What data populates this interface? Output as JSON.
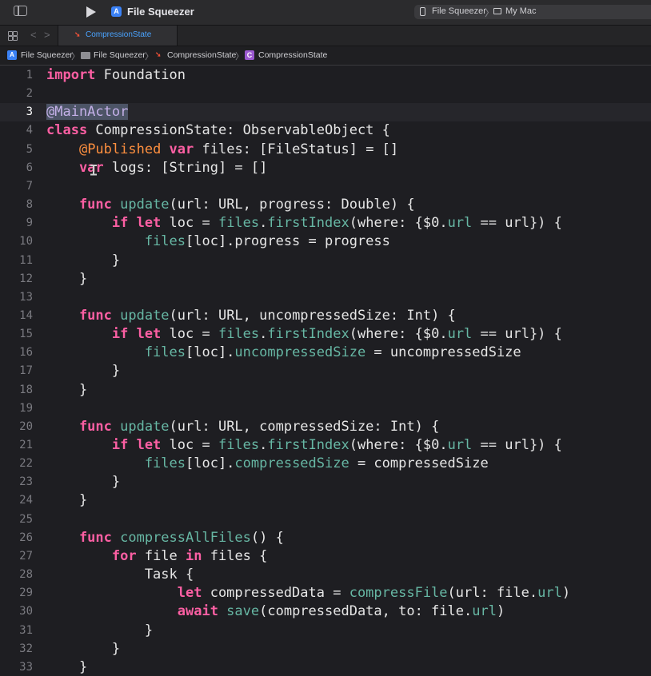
{
  "toolbar": {
    "project_title": "File Squeezer",
    "scheme": "File Squeezer",
    "destination": "My Mac"
  },
  "tabs": [
    {
      "label": "CompressionState",
      "active": true,
      "icon": "swift-icon"
    }
  ],
  "breadcrumb": [
    {
      "label": "File Squeezer",
      "icon": "project-icon"
    },
    {
      "label": "File Squeezer",
      "icon": "folder-icon"
    },
    {
      "label": "CompressionState",
      "icon": "swift-file-icon"
    },
    {
      "label": "CompressionState",
      "icon": "class-icon"
    }
  ],
  "editor": {
    "current_line": 3,
    "selected_text": "@MainActor",
    "lines": [
      [
        [
          "kw",
          "import"
        ],
        [
          "",
          "Foundation"
        ]
      ],
      [],
      [
        [
          "hl",
          "@MainActor"
        ]
      ],
      [
        [
          "kw",
          "class"
        ],
        [
          "",
          "CompressionState: ObservableObject {"
        ]
      ],
      [
        [
          "",
          "    "
        ],
        [
          "at",
          "@Published"
        ],
        [
          "kw",
          " var"
        ],
        [
          "",
          "files: [FileStatus] = []"
        ]
      ],
      [
        [
          "kw",
          "    var"
        ],
        [
          "",
          "logs: [String] = []"
        ]
      ],
      [],
      [
        [
          "kw",
          "    func"
        ],
        [
          "fn",
          "update"
        ],
        [
          "",
          "(url: URL, progress: Double) {"
        ]
      ],
      [
        [
          "kw",
          "        if let"
        ],
        [
          "",
          "loc ="
        ],
        [
          "pr",
          "files"
        ],
        [
          "",
          "."
        ],
        [
          "fn",
          "firstIndex"
        ],
        [
          "",
          "(where: {$0."
        ],
        [
          "pr",
          "url"
        ],
        [
          "",
          "== url}) {"
        ]
      ],
      [
        [
          "pr",
          "            files"
        ],
        [
          "",
          "[loc].progress = progress"
        ]
      ],
      [
        [
          "",
          "        }"
        ]
      ],
      [
        [
          "",
          "    }"
        ]
      ],
      [],
      [
        [
          "kw",
          "    func"
        ],
        [
          "fn",
          "update"
        ],
        [
          "",
          "(url: URL, uncompressedSize: Int) {"
        ]
      ],
      [
        [
          "kw",
          "        if let"
        ],
        [
          "",
          "loc ="
        ],
        [
          "pr",
          "files"
        ],
        [
          "",
          "."
        ],
        [
          "fn",
          "firstIndex"
        ],
        [
          "",
          "(where: {$0."
        ],
        [
          "pr",
          "url"
        ],
        [
          "",
          "== url}) {"
        ]
      ],
      [
        [
          "pr",
          "            files"
        ],
        [
          "",
          "[loc]."
        ],
        [
          "pr",
          "uncompressedSize"
        ],
        [
          "",
          "= uncompressedSize"
        ]
      ],
      [
        [
          "",
          "        }"
        ]
      ],
      [
        [
          "",
          "    }"
        ]
      ],
      [],
      [
        [
          "kw",
          "    func"
        ],
        [
          "fn",
          "update"
        ],
        [
          "",
          "(url: URL, compressedSize: Int) {"
        ]
      ],
      [
        [
          "kw",
          "        if let"
        ],
        [
          "",
          "loc ="
        ],
        [
          "pr",
          "files"
        ],
        [
          "",
          "."
        ],
        [
          "fn",
          "firstIndex"
        ],
        [
          "",
          "(where: {$0."
        ],
        [
          "pr",
          "url"
        ],
        [
          "",
          "== url}) {"
        ]
      ],
      [
        [
          "pr",
          "            files"
        ],
        [
          "",
          "[loc]."
        ],
        [
          "pr",
          "compressedSize"
        ],
        [
          "",
          "= compressedSize"
        ]
      ],
      [
        [
          "",
          "        }"
        ]
      ],
      [
        [
          "",
          "    }"
        ]
      ],
      [],
      [
        [
          "kw",
          "    func"
        ],
        [
          "fn",
          "compressAllFiles"
        ],
        [
          "",
          "() {"
        ]
      ],
      [
        [
          "kw",
          "        for"
        ],
        [
          "",
          "file"
        ],
        [
          "kw",
          "in"
        ],
        [
          "",
          "files {"
        ]
      ],
      [
        [
          "",
          "            Task {"
        ]
      ],
      [
        [
          "kw",
          "                let"
        ],
        [
          "",
          "compressedData ="
        ],
        [
          "fn",
          "compressFile"
        ],
        [
          "",
          "(url: file."
        ],
        [
          "pr",
          "url"
        ],
        [
          "",
          ")"
        ]
      ],
      [
        [
          "kw",
          "                await"
        ],
        [
          "fn",
          "save"
        ],
        [
          "",
          "(compressedData, to: file."
        ],
        [
          "pr",
          "url"
        ],
        [
          "",
          ")"
        ]
      ],
      [
        [
          "",
          "            }"
        ]
      ],
      [
        [
          "",
          "        }"
        ]
      ],
      [
        [
          "",
          "    }"
        ]
      ]
    ]
  },
  "colors": {
    "keyword": "#fc5fa3",
    "type": "#dabaff",
    "function": "#67b7a4",
    "attribute": "#fd8f3f",
    "plain": "#e6e6e6",
    "selection": "#4c5466",
    "accent": "#4aa3ff"
  }
}
